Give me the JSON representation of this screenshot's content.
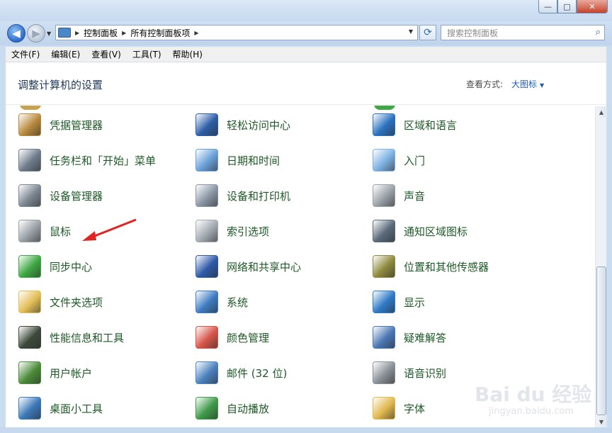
{
  "window": {
    "minimize_label": "—",
    "maximize_label": "□",
    "close_label": "✕"
  },
  "nav": {
    "back_glyph": "◀",
    "forward_glyph": "▶",
    "dropdown_glyph": "▼",
    "breadcrumb": [
      "控制面板",
      "所有控制面板项"
    ],
    "breadcrumb_sep": "▶",
    "refresh_glyph": "⟳",
    "search_placeholder": "搜索控制面板",
    "search_icon": "search-icon"
  },
  "menu": [
    "文件(F)",
    "编辑(E)",
    "查看(V)",
    "工具(T)",
    "帮助(H)"
  ],
  "header": {
    "title": "调整计算机的设置",
    "view_by_label": "查看方式:",
    "view_by_value": "大图标",
    "caret": "▼"
  },
  "items": {
    "col1": [
      {
        "label": "凭据管理器",
        "icon": "credential-vault-icon",
        "color": "#b98a3e"
      },
      {
        "label": "任务栏和「开始」菜单",
        "icon": "taskbar-icon",
        "color": "#6f7c8c"
      },
      {
        "label": "设备管理器",
        "icon": "device-manager-icon",
        "color": "#7d8792"
      },
      {
        "label": "鼠标",
        "icon": "mouse-icon",
        "color": "#9aa0a7"
      },
      {
        "label": "同步中心",
        "icon": "sync-center-icon",
        "color": "#3ea843"
      },
      {
        "label": "文件夹选项",
        "icon": "folder-options-icon",
        "color": "#e3bf57"
      },
      {
        "label": "性能信息和工具",
        "icon": "performance-icon",
        "color": "#3d4a3a"
      },
      {
        "label": "用户帐户",
        "icon": "user-accounts-icon",
        "color": "#4d8c3a"
      },
      {
        "label": "桌面小工具",
        "icon": "desktop-gadgets-icon",
        "color": "#3b78b8"
      }
    ],
    "col2": [
      {
        "label": "轻松访问中心",
        "icon": "ease-of-access-icon",
        "color": "#2d5fa8"
      },
      {
        "label": "日期和时间",
        "icon": "date-time-icon",
        "color": "#6aa0d8"
      },
      {
        "label": "设备和打印机",
        "icon": "devices-printers-icon",
        "color": "#8a96a4"
      },
      {
        "label": "索引选项",
        "icon": "indexing-icon",
        "color": "#a4aab2"
      },
      {
        "label": "网络和共享中心",
        "icon": "network-sharing-icon",
        "color": "#2f5aa8"
      },
      {
        "label": "系统",
        "icon": "system-icon",
        "color": "#3e7cc1"
      },
      {
        "label": "颜色管理",
        "icon": "color-management-icon",
        "color": "#d8554a"
      },
      {
        "label": "邮件 (32 位)",
        "icon": "mail-icon",
        "color": "#4b82bf"
      },
      {
        "label": "自动播放",
        "icon": "autoplay-icon",
        "color": "#3f9a4a"
      }
    ],
    "col3": [
      {
        "label": "区域和语言",
        "icon": "region-language-icon",
        "color": "#2c73c0"
      },
      {
        "label": "入门",
        "icon": "getting-started-icon",
        "color": "#7db2e3"
      },
      {
        "label": "声音",
        "icon": "sound-icon",
        "color": "#9aa1a8"
      },
      {
        "label": "通知区域图标",
        "icon": "notification-area-icon",
        "color": "#5b6a7b"
      },
      {
        "label": "位置和其他传感器",
        "icon": "location-sensors-icon",
        "color": "#8f8a3e"
      },
      {
        "label": "显示",
        "icon": "display-icon",
        "color": "#2f7bc7"
      },
      {
        "label": "疑难解答",
        "icon": "troubleshooting-icon",
        "color": "#4b78b5"
      },
      {
        "label": "语音识别",
        "icon": "speech-recognition-icon",
        "color": "#8a9099"
      },
      {
        "label": "字体",
        "icon": "fonts-icon",
        "color": "#e0b84d"
      }
    ]
  },
  "annotation": {
    "arrow_color": "#e02424"
  },
  "watermark": {
    "text": "Bai du 经验",
    "sub": "jingyan.baidu.com"
  }
}
